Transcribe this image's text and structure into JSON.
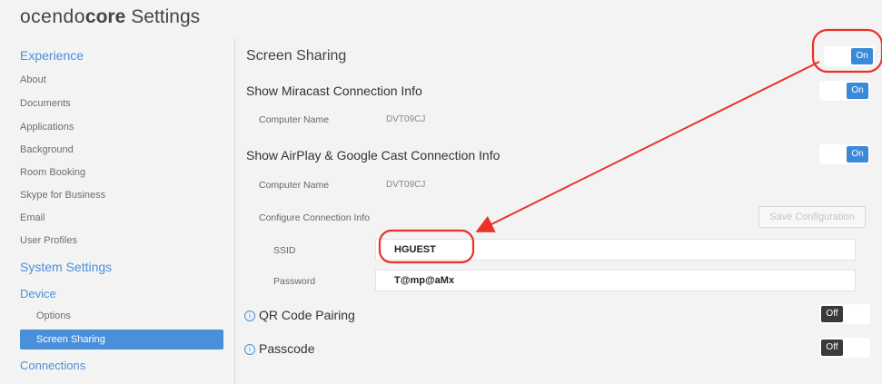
{
  "app": {
    "brand_light": "ocendo",
    "brand_bold": "core",
    "title_suffix": "Settings"
  },
  "sidebar": {
    "experience_label": "Experience",
    "experience_items": [
      "About",
      "Documents",
      "Applications",
      "Background",
      "Room Booking",
      "Skype for Business",
      "Email",
      "User Profiles"
    ],
    "system_settings_label": "System Settings",
    "device_label": "Device",
    "device_items": [
      "Options",
      "Screen Sharing"
    ],
    "active_item": "Screen Sharing",
    "connections_label": "Connections"
  },
  "main": {
    "screen_sharing": {
      "title": "Screen Sharing",
      "toggle": "On"
    },
    "miracast": {
      "title": "Show Miracast Connection Info",
      "toggle": "On",
      "computer_name_label": "Computer Name",
      "computer_name_value": "DVT09CJ"
    },
    "airplay": {
      "title": "Show AirPlay & Google Cast Connection Info",
      "toggle": "On",
      "computer_name_label": "Computer Name",
      "computer_name_value": "DVT09CJ",
      "configure_label": "Configure Connection Info",
      "save_button": "Save Configuration",
      "ssid_label": "SSID",
      "ssid_value": "HGUEST",
      "password_label": "Password",
      "password_value": "T@mp@aMx"
    },
    "qr_code": {
      "title": "QR Code Pairing",
      "toggle": "Off"
    },
    "passcode": {
      "title": "Passcode",
      "toggle": "Off"
    }
  },
  "colors": {
    "accent": "#4a90d9",
    "toggle_on": "#3b8ad9",
    "toggle_off": "#3a3a3a",
    "annotation": "#e8322a"
  },
  "icons": {
    "info": "info-icon",
    "annotation_arrow": "arrow-icon"
  }
}
